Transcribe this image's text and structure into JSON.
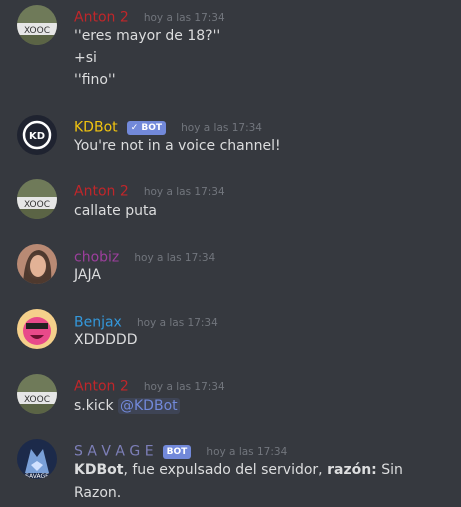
{
  "colors": {
    "background": "#36393f",
    "anton_color": "#c0262a",
    "kdbot_color": "#f1c40f",
    "chobiz_color": "#9c3f9c",
    "benjax_color": "#3498db",
    "savage_color": "#7d7fb8",
    "bot_badge": "#7289da",
    "mention": "#7289da"
  },
  "messages": [
    {
      "author": "Anton 2",
      "timestamp": "hoy a las 17:34",
      "lines": [
        "''eres mayor de 18?''",
        "+si",
        "''fino''"
      ],
      "avatar_icon": "user-avatar-icon"
    },
    {
      "author": "KDBot",
      "bot_badge": "✓ BOT",
      "timestamp": "hoy a las 17:34",
      "lines": [
        "You're not in a voice channel!"
      ],
      "avatar_icon": "kd-logo-icon"
    },
    {
      "author": "Anton 2",
      "timestamp": "hoy a las 17:34",
      "lines": [
        "callate puta"
      ],
      "avatar_icon": "user-avatar-icon"
    },
    {
      "author": "chobiz",
      "timestamp": "hoy a las 17:34",
      "lines": [
        "JAJA"
      ],
      "avatar_icon": "user-photo-icon"
    },
    {
      "author": "Benjax",
      "timestamp": "hoy a las 17:34",
      "lines": [
        "XDDDDD"
      ],
      "avatar_icon": "sunglasses-face-icon"
    },
    {
      "author": "Anton 2",
      "timestamp": "hoy a las 17:34",
      "command": "s.kick",
      "mention": "@KDBot",
      "avatar_icon": "user-avatar-icon"
    },
    {
      "author": "S A V A G E",
      "bot_badge": "BOT",
      "timestamp": "hoy a las 17:34",
      "kick_target": "KDBot",
      "kick_text": ", fue expulsado del servidor, ",
      "reason_label": "razón:",
      "reason_value_1": " Sin",
      "reason_value_2": "Razon.",
      "avatar_icon": "wolf-avatar-icon"
    }
  ]
}
